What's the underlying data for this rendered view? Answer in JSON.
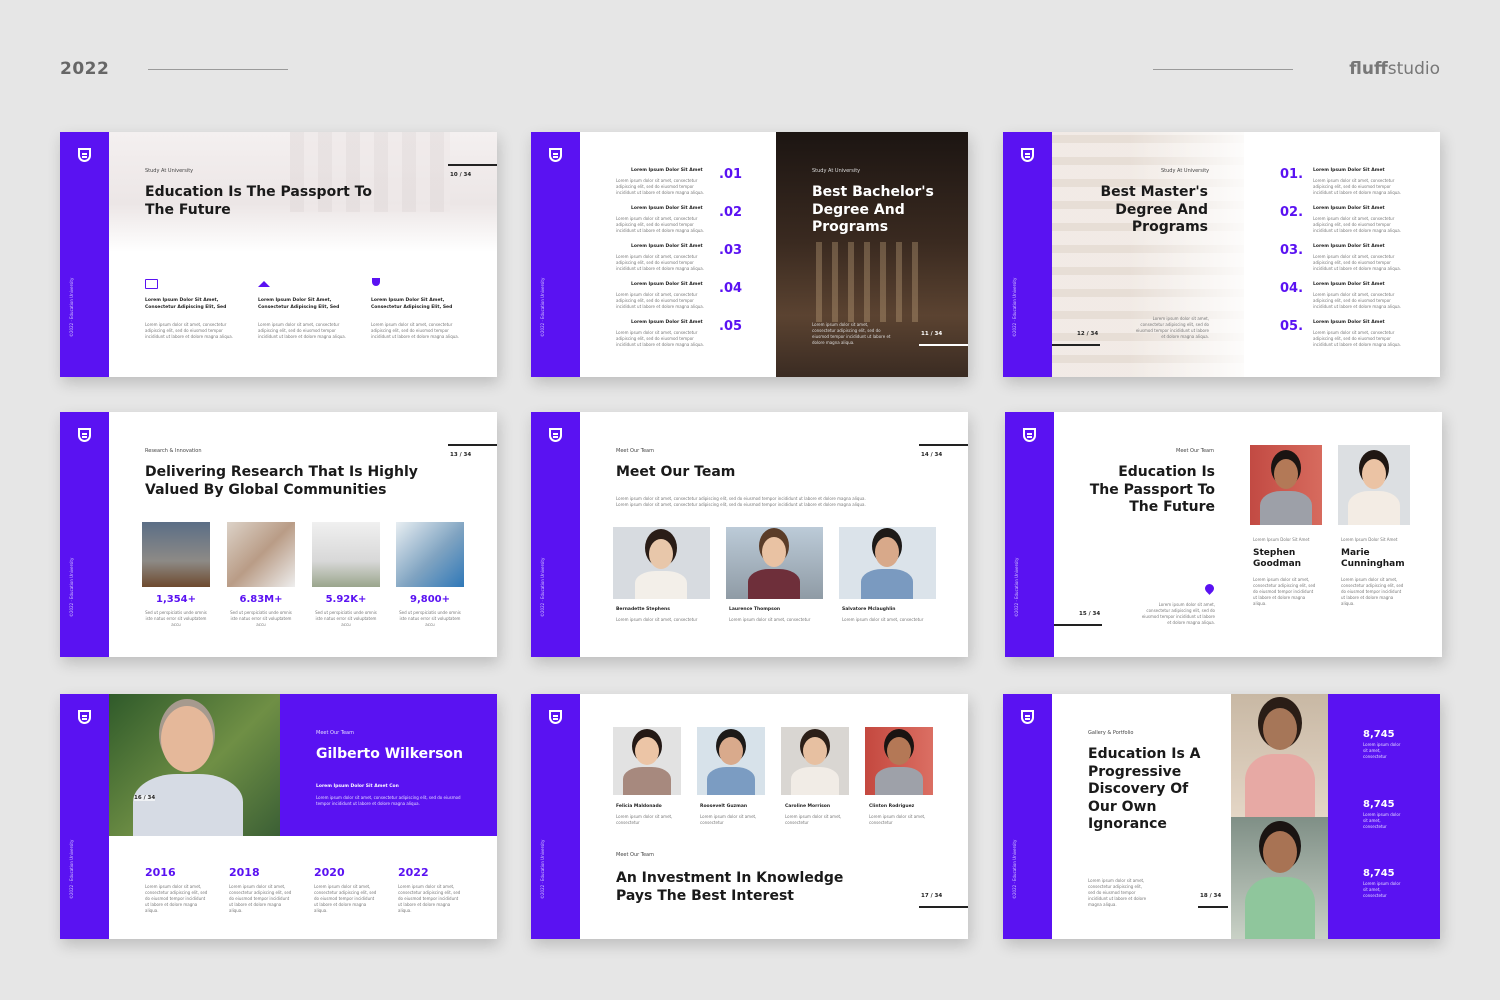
{
  "header": {
    "year": "2022",
    "brand_bold": "fluff",
    "brand_rest": "studio"
  },
  "common": {
    "lorem_title": "Lorem Ipsum Dolor Sit Amet",
    "lorem_line": "Lorem ipsum dolor sit amet, consectetur adipiscing elit, sed do eiusmod tempor incididunt ut labore et dolore magna aliqua.",
    "lorem_short": "Lorem ipsum dolor sit amet, consectetur",
    "vertical": "©2022 · Education University"
  },
  "slide1": {
    "tag": "Study At University",
    "title": "Education Is The Passport To The Future",
    "page": "10 / 34",
    "features": [
      {
        "title": "Lorem Ipsum Dolor Sit Amet, Consectetur Adipiscing Elit, Sed",
        "icon": "diploma-icon"
      },
      {
        "title": "Lorem Ipsum Dolor Sit Amet, Consectetur Adipiscing Elit, Sed",
        "icon": "graduation-cap-icon"
      },
      {
        "title": "Lorem Ipsum Dolor Sit Amet, Consectetur Adipiscing Elit, Sed",
        "icon": "trophy-icon"
      }
    ]
  },
  "slide2": {
    "items": [
      ".01",
      ".02",
      ".03",
      ".04",
      ".05"
    ],
    "tag": "Study At University",
    "title": "Best Bachelor's Degree And Programs",
    "page": "11 / 34"
  },
  "slide3": {
    "tag": "Study At University",
    "title": "Best Master's Degree And Programs",
    "page": "12 / 34",
    "items": [
      "01.",
      "02.",
      "03.",
      "04.",
      "05."
    ]
  },
  "slide4": {
    "tag": "Research & Innovation",
    "title": "Delivering Research That Is Highly Valued By Global Communities",
    "page": "13 / 34",
    "stats": [
      "1,354+",
      "6.83M+",
      "5.92K+",
      "9,800+"
    ],
    "stat_desc": "Sed ut perspiciatis unde omnis iste natus error sit voluptatem accu"
  },
  "slide5": {
    "tag": "Meet Our Team",
    "title": "Meet Our Team",
    "page": "14 / 34",
    "members": [
      "Bernadette Stephens",
      "Laurence Thompson",
      "Salvatore Mclaughlin"
    ]
  },
  "slide6": {
    "tag": "Meet Our Team",
    "title": "Education Is The Passport To The Future",
    "page": "15 / 34",
    "members": [
      "Stephen Goodman",
      "Marie Cunningham"
    ]
  },
  "slide7": {
    "tag": "Meet Our Team",
    "name": "Gilberto Wilkerson",
    "subtitle": "Lorem Ipsum Dolor Sit Amet Con",
    "page": "16 / 34",
    "years": [
      "2016",
      "2018",
      "2020",
      "2022"
    ]
  },
  "slide8": {
    "members": [
      "Felicia Maldonado",
      "Roosevelt Guzman",
      "Caroline Morrison",
      "Clinton Rodriguez"
    ],
    "tag": "Meet Our Team",
    "title": "An Investment In Knowledge Pays The Best Interest",
    "page": "17 / 34"
  },
  "slide9": {
    "tag": "Gallery & Portfolio",
    "title": "Education Is A Progressive Discovery Of Our Own Ignorance",
    "page": "18 / 34",
    "stats": [
      "8,745",
      "8,745",
      "8,745"
    ]
  },
  "colors": {
    "accent": "#5a12f2",
    "background": "#e6e6e6"
  }
}
